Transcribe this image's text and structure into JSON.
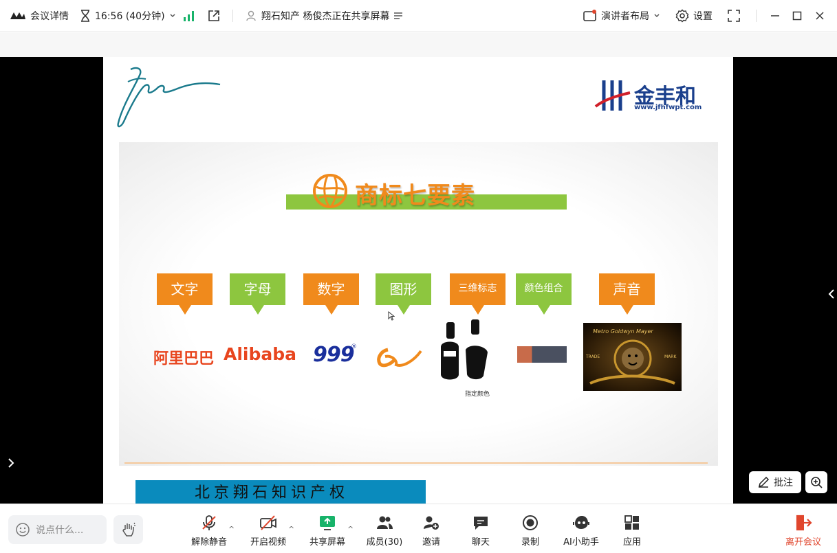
{
  "topbar": {
    "meeting_details": "会议详情",
    "time": "16:56 (40分钟)",
    "sharing_status": "翔石知产 杨俊杰正在共享屏幕",
    "layout_label": "演讲者布局",
    "settings_label": "设置"
  },
  "slide": {
    "brand_name": "金丰和",
    "brand_url": "www.jfhfwpt.com",
    "title": "商标七要素",
    "tags": [
      {
        "label": "文字"
      },
      {
        "label": "字母"
      },
      {
        "label": "数字"
      },
      {
        "label": "图形"
      },
      {
        "label": "三维标志"
      },
      {
        "label": "颜色组合"
      },
      {
        "label": "声音"
      }
    ],
    "samples": {
      "text_sample": "阿里巴巴",
      "letter_sample": "Alibaba",
      "number_sample": "999",
      "bottle_caption": "指定颜色",
      "mgm_top": "Metro Goldwyn Mayer",
      "mgm_left": "TRADE",
      "mgm_right": "MARK"
    },
    "banner_text": "北京翔石知识产权"
  },
  "overlay": {
    "annotate_label": "批注"
  },
  "bottombar": {
    "chat_placeholder": "说点什么...",
    "controls": [
      {
        "label": "解除静音"
      },
      {
        "label": "开启视频"
      },
      {
        "label": "共享屏幕"
      },
      {
        "label": "成员(30)"
      },
      {
        "label": "邀请"
      },
      {
        "label": "聊天"
      },
      {
        "label": "录制"
      },
      {
        "label": "AI小助手"
      },
      {
        "label": "应用"
      }
    ],
    "leave_label": "离开会议"
  },
  "colors": {
    "orange": "#f08a1c",
    "green": "#8dc63f",
    "banner_blue": "#0a8bbd",
    "leave_red": "#e0462d",
    "signal_green": "#18b36a"
  }
}
